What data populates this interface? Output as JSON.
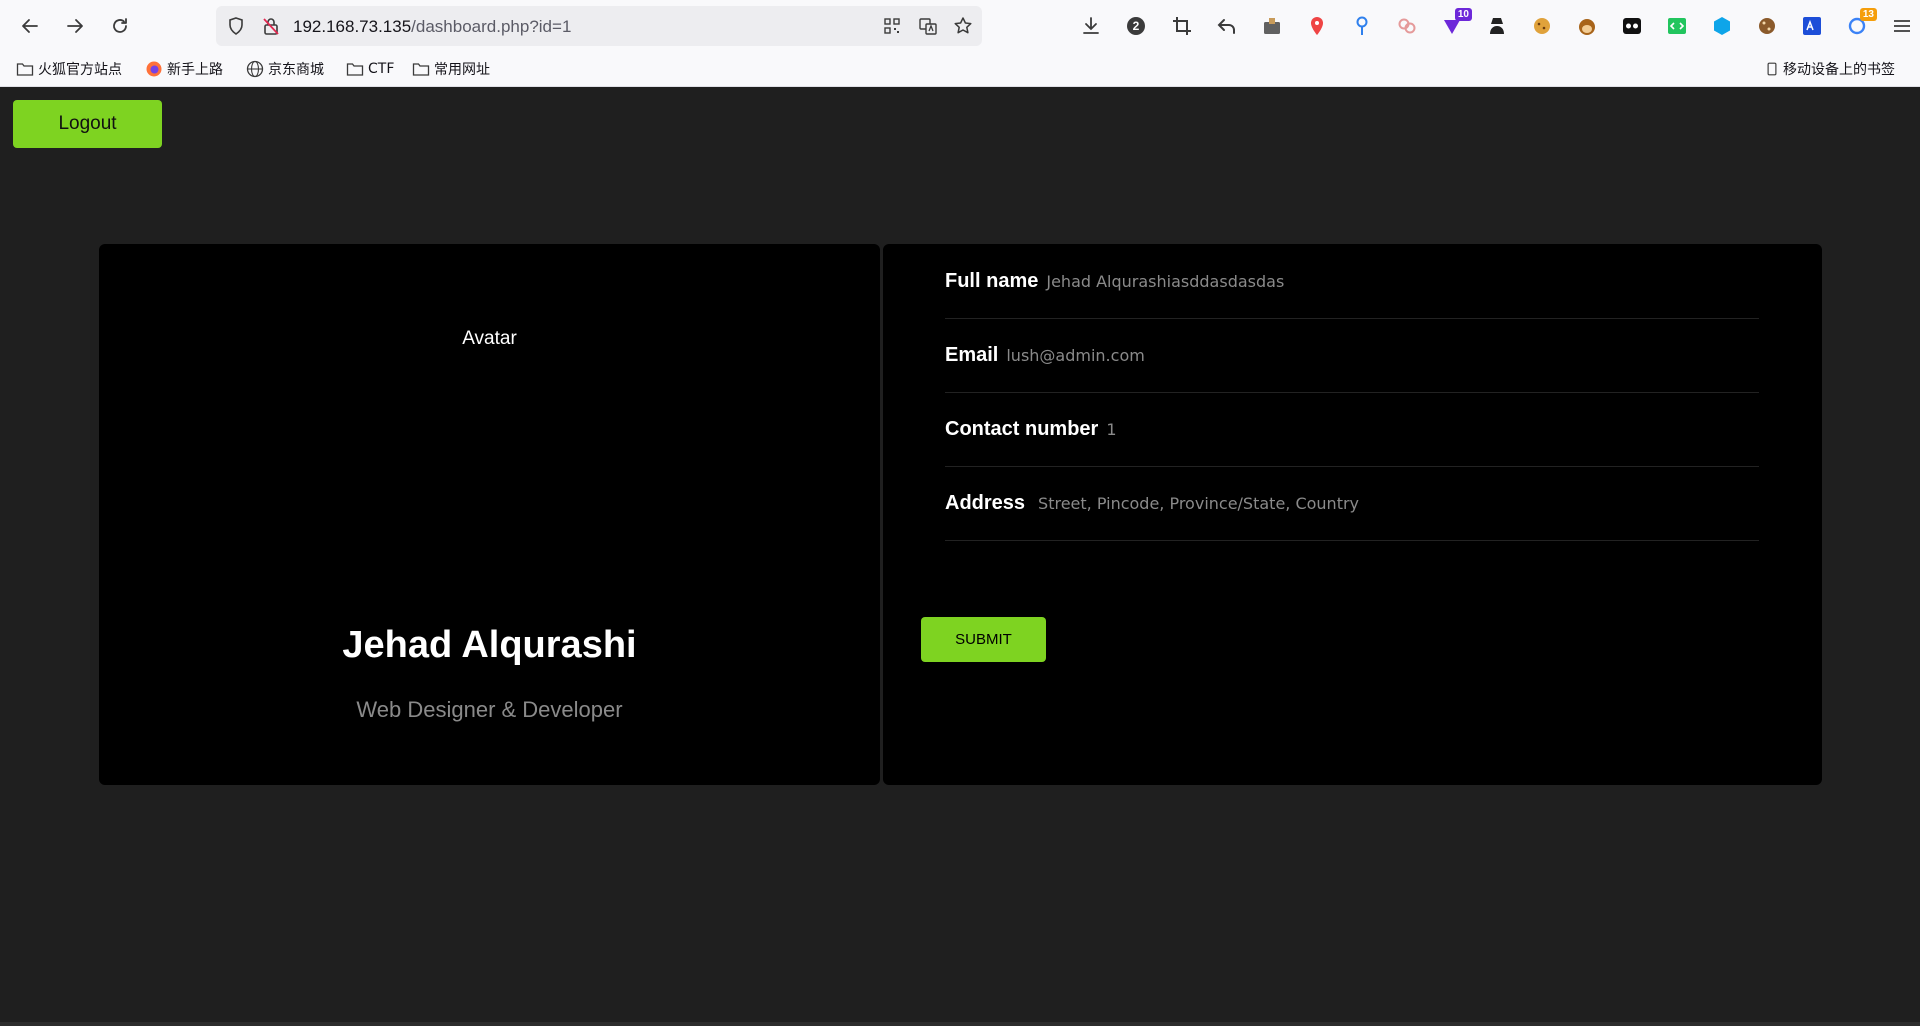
{
  "browser": {
    "url_host": "192.168.73.135",
    "url_path": "/dashboard.php?id=1",
    "extensions": [
      {
        "name": "download-icon",
        "color": "#3b3b3b"
      },
      {
        "name": "numbered-circle-icon",
        "color": "#3b3b3b",
        "text": "2"
      },
      {
        "name": "crop-icon",
        "color": "#3b3b3b"
      },
      {
        "name": "undo-icon",
        "color": "#3b3b3b"
      },
      {
        "name": "screenshot-icon",
        "color": "#3b3b3b"
      },
      {
        "name": "pin-icon",
        "color": "#ef4444"
      },
      {
        "name": "location-icon",
        "color": "#2f80ed"
      },
      {
        "name": "link-icon",
        "color": "#e59a9a"
      },
      {
        "name": "shield-download-icon",
        "color": "#6d28d9",
        "badge": "10",
        "badge_color": "#6d28d9"
      },
      {
        "name": "spy-icon",
        "color": "#222222"
      },
      {
        "name": "cookie-icon",
        "color": "#e0a23b"
      },
      {
        "name": "monkey-icon",
        "color": "#a8641a"
      },
      {
        "name": "glasses-icon",
        "color": "#111111"
      },
      {
        "name": "code-icon",
        "color": "#22c55e"
      },
      {
        "name": "cube-icon",
        "color": "#0ea5e9"
      },
      {
        "name": "cookie-editor-icon",
        "color": "#8b5a2b"
      },
      {
        "name": "translate-icon",
        "color": "#1d4ed8"
      },
      {
        "name": "sync-icon",
        "color": "#3b82f6",
        "badge": "13",
        "badge_color": "#f59e0b"
      },
      {
        "name": "menu-icon",
        "color": "#3b3b3b"
      }
    ]
  },
  "bookmarks": {
    "items": [
      {
        "label": "火狐官方站点",
        "icon": "folder-icon"
      },
      {
        "label": "新手上路",
        "icon": "firefox-icon"
      },
      {
        "label": "京东商城",
        "icon": "globe-icon"
      },
      {
        "label": "CTF",
        "icon": "folder-icon"
      },
      {
        "label": "常用网址",
        "icon": "folder-icon"
      }
    ],
    "mobile": "移动设备上的书签"
  },
  "page": {
    "logout_label": "Logout",
    "avatar_alt": "Avatar",
    "profile_name": "Jehad Alqurashi",
    "profile_role": "Web Designer & Developer",
    "fields": [
      {
        "label": "Full name",
        "value": "Jehad Alqurashiasddasdasdas"
      },
      {
        "label": "Email",
        "value": "lush@admin.com"
      },
      {
        "label": "Contact number",
        "value": "1"
      },
      {
        "label": "Address",
        "value": "Street, Pincode, Province/State, Country"
      }
    ],
    "submit_label": "SUBMIT",
    "accent_color": "#7ed321"
  }
}
